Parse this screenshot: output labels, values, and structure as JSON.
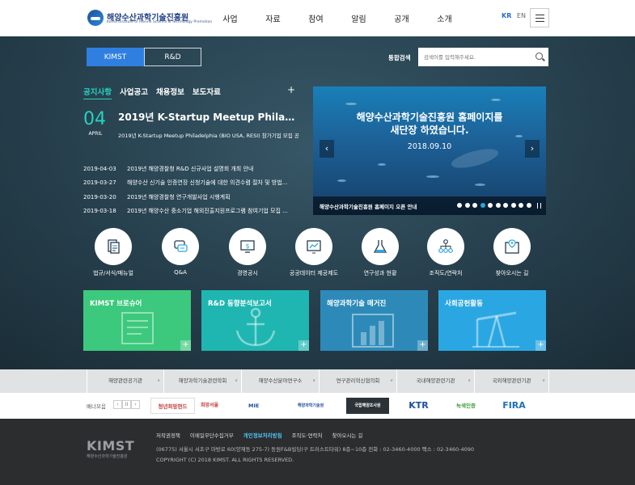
{
  "header": {
    "logo_title": "해양수산과학기술진흥원",
    "logo_sub": "Korea Institute of Marine Science & Technology Promotion",
    "nav": [
      "사업",
      "자료",
      "참여",
      "알림",
      "공개",
      "소개"
    ],
    "lang_kr": "KR",
    "lang_en": "EN",
    "menu_icon": "hamburger-icon"
  },
  "tabs": {
    "kimst": "KIMST",
    "rnd": "R&D"
  },
  "search": {
    "label": "통합검색",
    "placeholder": "검색어를 입력해주세요."
  },
  "notice": {
    "tabs": [
      "공지사항",
      "사업공고",
      "채용정보",
      "보도자료"
    ],
    "more": "+",
    "featured": {
      "day": "04",
      "month": "APRIL",
      "title": "2019년 K-Startup Meetup Philadelp...",
      "desc": "2019년 K-Startup Meetup Philadelphia (BIO USA, RESI) 참가기업 모집 공고"
    },
    "items": [
      {
        "date": "2019-04-03",
        "title": "2019년 해양경찰청 R&D 신규사업 설명회 개최 안내"
      },
      {
        "date": "2019-03-27",
        "title": "해양수산 신기술 인증연장 신청기술에 대한 의견수렴 절차 및 방법..."
      },
      {
        "date": "2019-03-20",
        "title": "2019년 해양경찰청 연구개발사업 시행계획"
      },
      {
        "date": "2019-03-18",
        "title": "2019년 해양수산 중소기업 해외진출지원프로그램 참여기업 모집 ..."
      }
    ]
  },
  "banner": {
    "title_line1": "해양수산과학기술진흥원 홈페이지를",
    "title_line2": "새단장 하였습니다.",
    "date": "2018.09.10",
    "caption": "해양수산과학기술진흥원 홈페이지 오픈 안내",
    "prev": "‹",
    "next": "›",
    "slide_count": 10,
    "active_slide": 4
  },
  "quick": [
    {
      "label": "법규/서식/매뉴얼",
      "icon": "document-icon"
    },
    {
      "label": "Q&A",
      "icon": "qa-icon"
    },
    {
      "label": "경영공시",
      "icon": "monitor-icon"
    },
    {
      "label": "공공데이터 제공제도",
      "icon": "chart-icon"
    },
    {
      "label": "연구성과 현황",
      "icon": "flask-icon"
    },
    {
      "label": "조직도/연락처",
      "icon": "org-chart-icon"
    },
    {
      "label": "찾아오시는 길",
      "icon": "map-icon"
    }
  ],
  "cards": [
    {
      "title": "KIMST 브로슈어",
      "color": "#3cc97d"
    },
    {
      "title": "R&D 동향분석보고서",
      "color": "#1fb6b1"
    },
    {
      "title": "해양과학기술 매거진",
      "color": "#2d8ab8"
    },
    {
      "title": "사회공헌활동",
      "color": "#2aa7e2"
    }
  ],
  "related": [
    "해양관련공기관",
    "해양과학기술관련학회",
    "해양수산분야연구소",
    "연구관리혁신협의회",
    "국내해양관련기관",
    "국외해양관련기관"
  ],
  "partners": {
    "label": "배너모음",
    "prev": "‹",
    "pause": "II",
    "next": "›",
    "items": [
      "청년희망펀드",
      "희망서울",
      "MIE",
      "해양과학기술원",
      "국립해양조사원",
      "KTR",
      "녹색인증",
      "FIRA"
    ]
  },
  "footer": {
    "brand": "KIMST",
    "brand_sub": "해양수산과학기술진흥원",
    "links": [
      "저작권정책",
      "이메일무단수집거부",
      "개인정보처리방침",
      "조직도·연락처",
      "찾아오시는 길"
    ],
    "address": "(06775) 서울시 서초구 마방로 60(양재동 275-7) 동원F&B빌딩(구 트러스트타워) 8층~10층  전화 : 02-3460-4000  팩스 : 02-3460-4090",
    "copyright": "COPYRIGHT (C) 2018 KIMST. ALL RIGHTS RESERVED."
  }
}
